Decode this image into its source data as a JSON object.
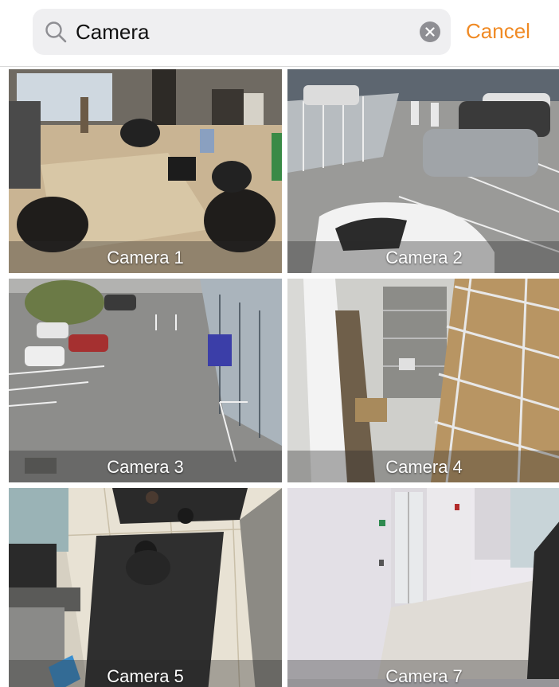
{
  "search": {
    "query": "Camera",
    "cancel_label": "Cancel"
  },
  "colors": {
    "accent": "#f08a24",
    "search_field_bg": "#efeff1",
    "clear_button_bg": "#8e8e93"
  },
  "icons": {
    "search": "magnifier-icon",
    "clear": "x-circle-icon"
  },
  "cameras": [
    {
      "label": "Camera 1",
      "scene": "lobby with armchairs"
    },
    {
      "label": "Camera 2",
      "scene": "parking lot with cars"
    },
    {
      "label": "Camera 3",
      "scene": "outdoor parking area"
    },
    {
      "label": "Camera 4",
      "scene": "warehouse shelves"
    },
    {
      "label": "Camera 5",
      "scene": "overhead entrance view"
    },
    {
      "label": "Camera 7",
      "scene": "white corridor"
    }
  ]
}
